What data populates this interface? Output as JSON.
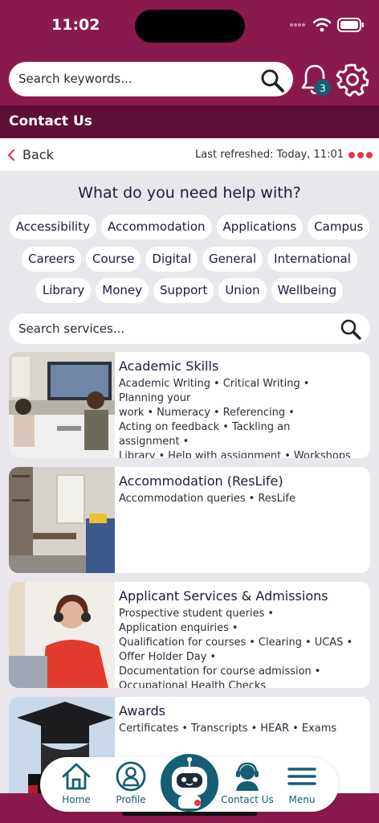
{
  "status": {
    "time": "11:02"
  },
  "search": {
    "placeholder": "Search keywords..."
  },
  "notifications": {
    "count": "3"
  },
  "section": {
    "title": "Contact Us"
  },
  "nav": {
    "back_label": "Back",
    "refreshed": "Last refreshed: Today, 11:01"
  },
  "help": {
    "title": "What do you need help with?"
  },
  "categories": {
    "row1": [
      "Accessibility",
      "Accommodation",
      "Applications",
      "Campus"
    ],
    "row2": [
      "Careers",
      "Course",
      "Digital",
      "General",
      "International"
    ],
    "row3": [
      "Library",
      "Money",
      "Support",
      "Union",
      "Wellbeing"
    ]
  },
  "services_search": {
    "placeholder": "Search services..."
  },
  "services": [
    {
      "title": "Academic Skills",
      "tags": [
        "Academic Writing",
        "Critical Writing",
        "Planning your work",
        "Numeracy",
        "Referencing",
        "Acting on feedback",
        "Tackling an assignment",
        "Library",
        "Help with assignment",
        "Workshops"
      ]
    },
    {
      "title": "Accommodation (ResLife)",
      "tags": [
        "Accommodation queries",
        "ResLife"
      ]
    },
    {
      "title": "Applicant Services & Admissions",
      "tags": [
        "Prospective student queries",
        "Application enquiries",
        "Qualification for courses",
        "Clearing",
        "UCAS",
        "Offer Holder Day",
        "Documentation for course admission",
        "Occupational Health Checks"
      ]
    },
    {
      "title": "Awards",
      "tags": [
        "Certificates",
        "Transcripts",
        "HEAR",
        "Exams"
      ]
    }
  ],
  "tabs": {
    "home": "Home",
    "profile": "Profile",
    "contact": "Contact Us",
    "menu": "Menu"
  },
  "colors": {
    "brand": "#8a1a4d",
    "brand_dark": "#5e0f35",
    "accent": "#155e73",
    "alert": "#e2394d"
  }
}
